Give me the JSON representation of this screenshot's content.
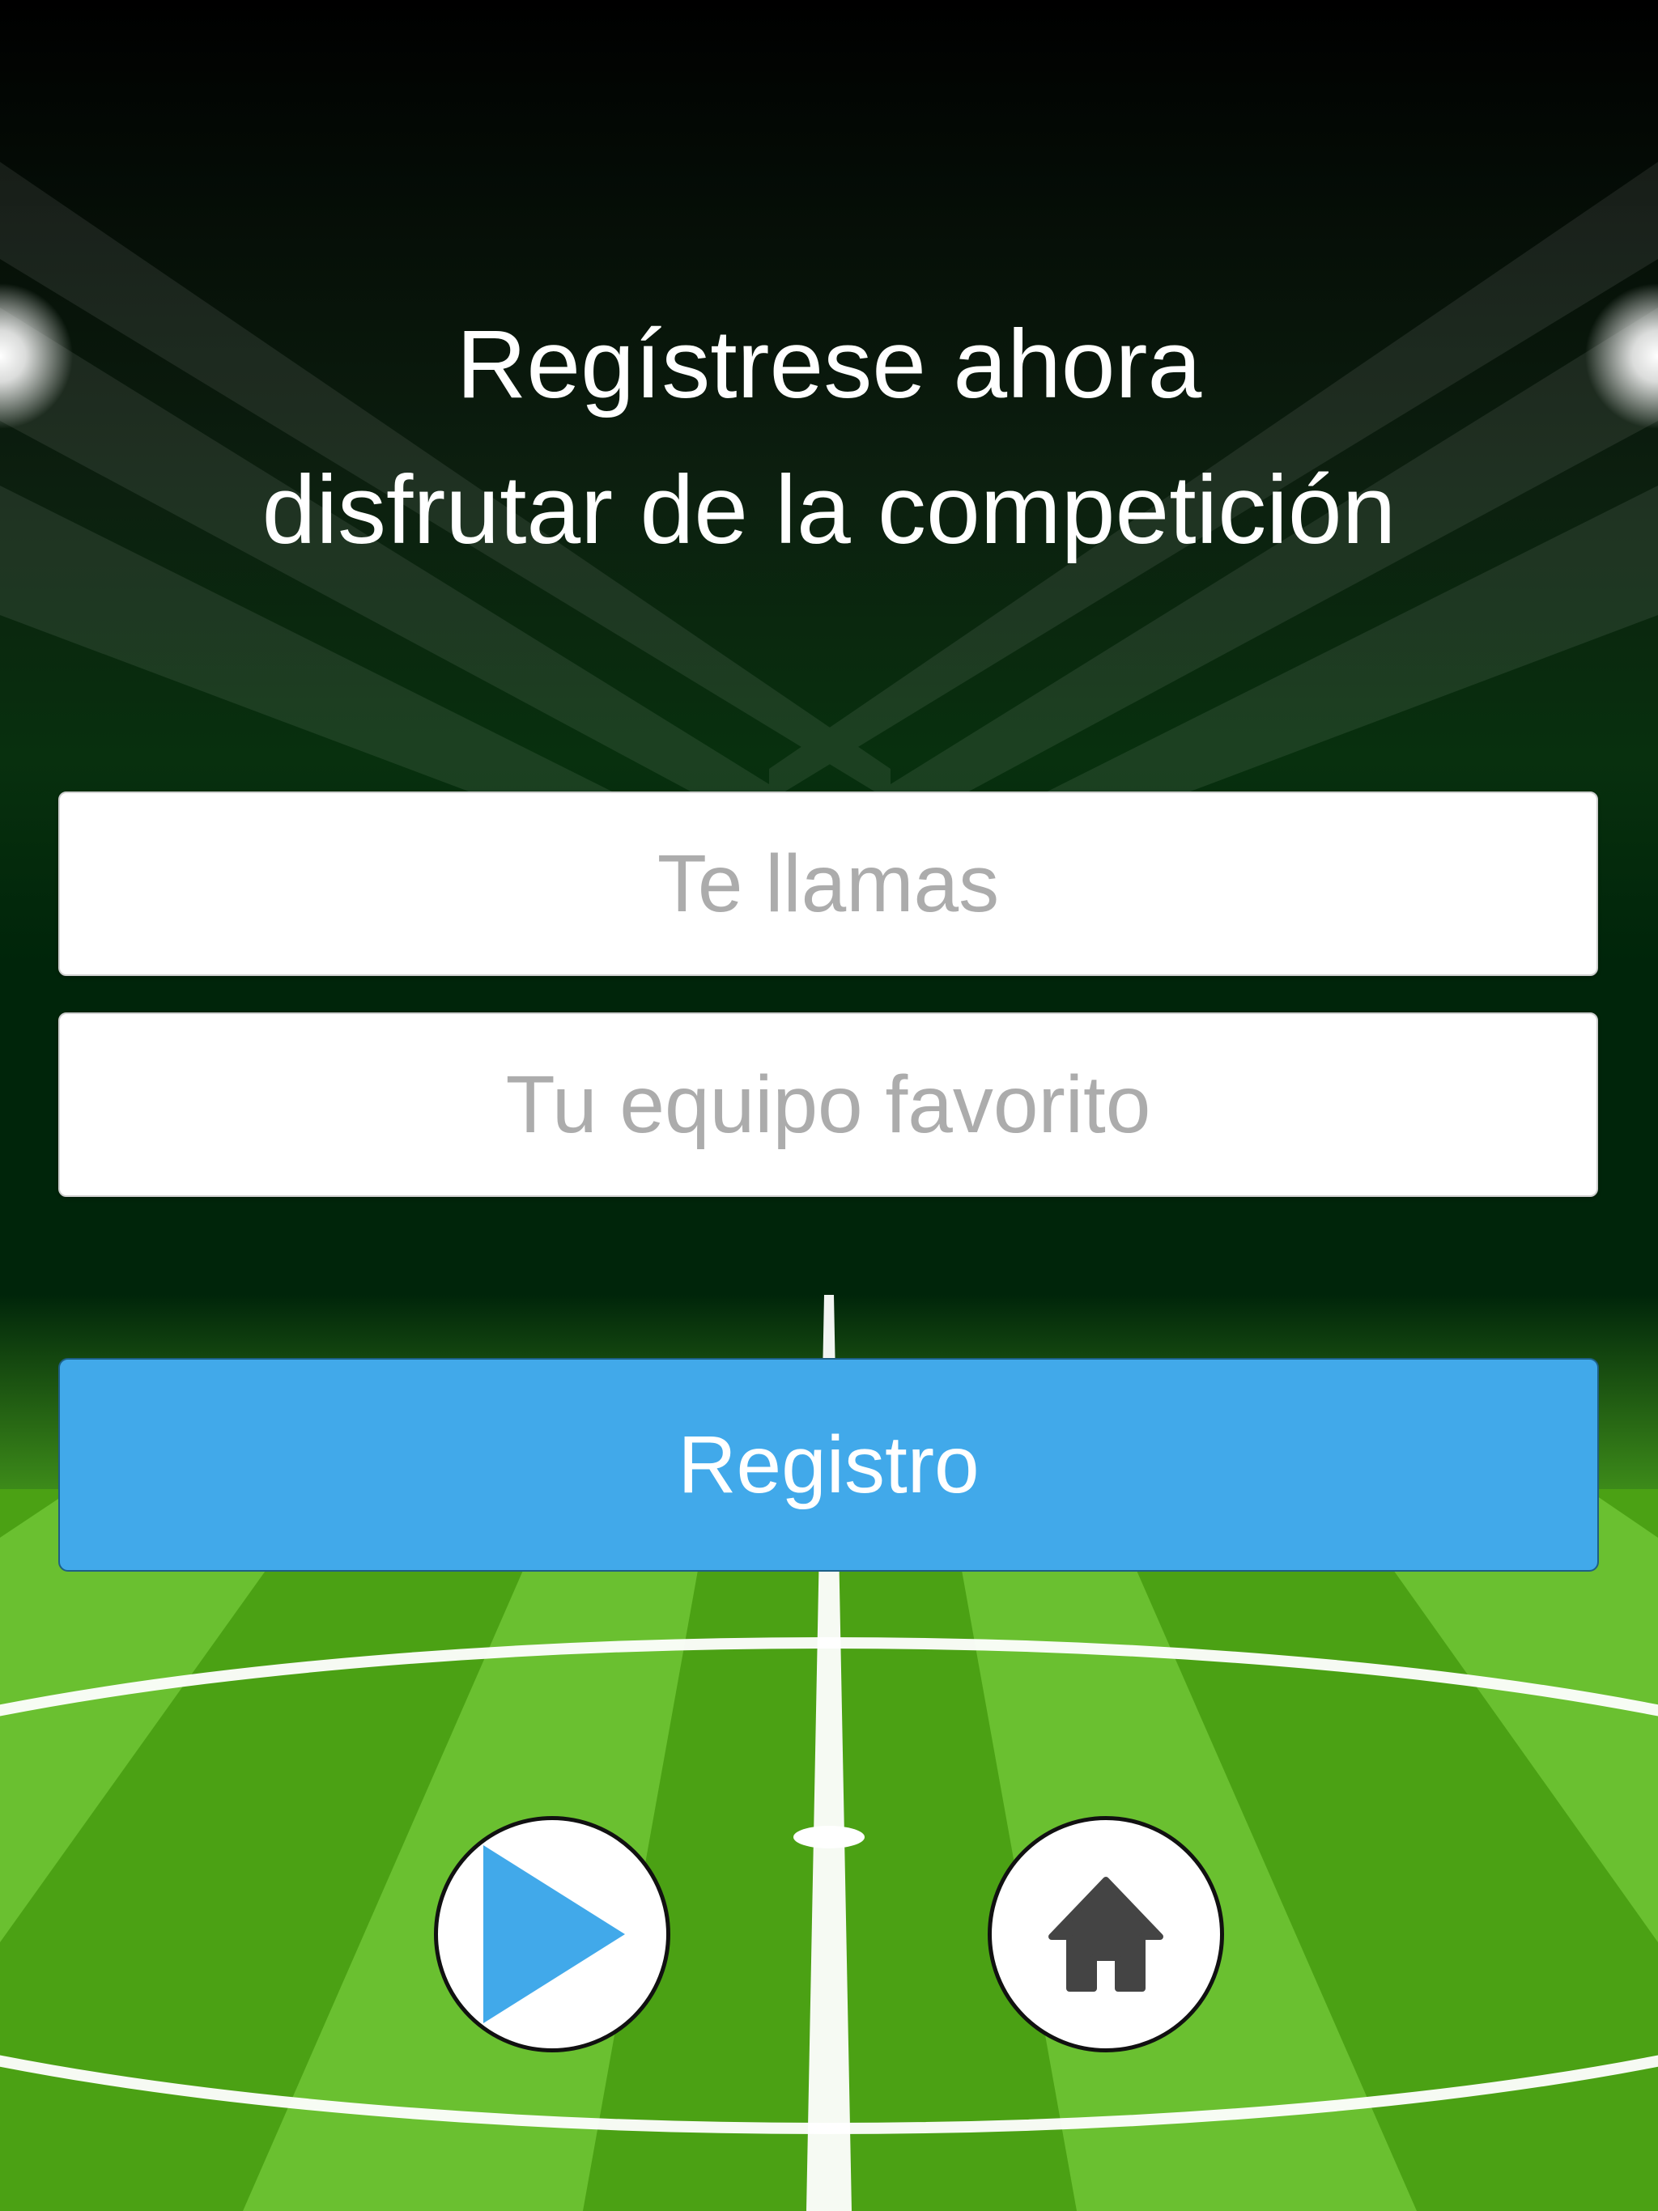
{
  "header": {
    "title_line1": "Regístrese ahora",
    "title_line2": "disfrutar de la competición"
  },
  "form": {
    "name_placeholder": "Te llamas",
    "team_placeholder": "Tu equipo favorito",
    "register_label": "Registro"
  },
  "icons": {
    "play": "play-icon",
    "home": "home-icon"
  },
  "colors": {
    "accent": "#41a9ea",
    "pitch_light": "#6ac030",
    "pitch_dark": "#4ba114",
    "stadium_dark": "#00260a",
    "home_icon": "#444444"
  }
}
